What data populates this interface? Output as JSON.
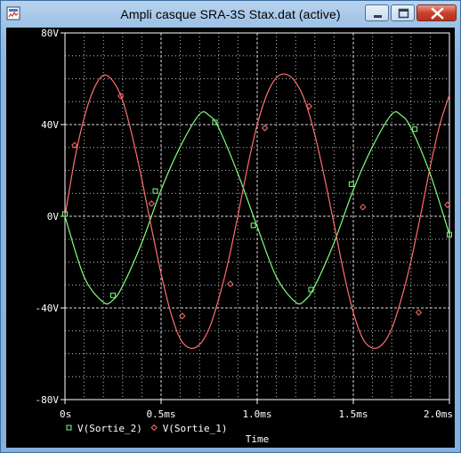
{
  "window": {
    "title": "Ampli casque SRA-3S Stax.dat (active)",
    "icons": [
      "app-probe-icon",
      "minimize-icon",
      "maximize-icon",
      "close-icon"
    ]
  },
  "colors": {
    "background": "#000000",
    "grid": "#ffffff",
    "series_sortie_2": "#7dff7d",
    "series_sortie_1": "#ff6f6f"
  },
  "chart_data": {
    "type": "line",
    "xlabel": "Time",
    "ylabel": "",
    "xlim": [
      0,
      2.0
    ],
    "ylim": [
      -80,
      80
    ],
    "x_unit": "ms",
    "y_unit": "V",
    "x_ticks": [
      0,
      0.5,
      1.0,
      1.5,
      2.0
    ],
    "x_tick_labels": [
      "0s",
      "0.5ms",
      "1.0ms",
      "1.5ms",
      "2.0ms"
    ],
    "y_ticks": [
      80,
      40,
      0,
      -40,
      -80
    ],
    "y_tick_labels": [
      "80V",
      "40V",
      "0V",
      "-40V",
      "-80V"
    ],
    "grid": true,
    "legend_position": "bottom-left",
    "series": [
      {
        "name": "V(Sortie_2)",
        "marker": "square",
        "color": "#7dff7d",
        "x": [
          0,
          0.1,
          0.2,
          0.25,
          0.3,
          0.4,
          0.5,
          0.6,
          0.7,
          0.75,
          0.8,
          0.9,
          1.0,
          1.1,
          1.2,
          1.25,
          1.3,
          1.4,
          1.5,
          1.6,
          1.7,
          1.75,
          1.8,
          1.9,
          2.0
        ],
        "values": [
          0,
          -26.5,
          -37.5,
          -36.5,
          -30.4,
          -11.5,
          11.5,
          30.4,
          44.5,
          44.0,
          38.5,
          18.5,
          -4.5,
          -26.5,
          -37.5,
          -36.5,
          -30.4,
          -11.5,
          11.5,
          30.4,
          44.5,
          44.0,
          38.5,
          18.5,
          -8.0
        ],
        "marker_points": [
          [
            0.0,
            1.0
          ],
          [
            0.25,
            -34.5
          ],
          [
            0.47,
            11.0
          ],
          [
            0.78,
            41.0
          ],
          [
            0.98,
            -4.0
          ],
          [
            1.28,
            -32.0
          ],
          [
            1.49,
            14.0
          ],
          [
            1.82,
            38.0
          ],
          [
            2.0,
            -8.0
          ]
        ]
      },
      {
        "name": "V(Sortie_1)",
        "marker": "diamond",
        "color": "#ff6f6f",
        "x": [
          0,
          0.05,
          0.1,
          0.15,
          0.2,
          0.25,
          0.3,
          0.35,
          0.4,
          0.45,
          0.5,
          0.55,
          0.6,
          0.65,
          0.7,
          0.75,
          0.8,
          0.85,
          0.9,
          0.95,
          1.0,
          1.05,
          1.1,
          1.15,
          1.2,
          1.25,
          1.3,
          1.35,
          1.4,
          1.45,
          1.5,
          1.55,
          1.6,
          1.65,
          1.7,
          1.75,
          1.8,
          1.85,
          1.9,
          1.95,
          2.0
        ],
        "values": [
          0,
          24.5,
          43.0,
          55.5,
          61.5,
          59.0,
          50.5,
          35.0,
          16.0,
          -5.0,
          -25.0,
          -42.0,
          -53.5,
          -57.5,
          -56.0,
          -49.0,
          -36.0,
          -19.5,
          0.5,
          21.5,
          40.0,
          53.0,
          60.5,
          62.0,
          58.5,
          50.0,
          35.5,
          17.0,
          -3.5,
          -24.5,
          -42.0,
          -53.5,
          -57.5,
          -56.0,
          -49.0,
          -36.0,
          -19.5,
          0.5,
          21.5,
          40.0,
          53.0
        ],
        "marker_points": [
          [
            0.05,
            31.0
          ],
          [
            0.29,
            52.5
          ],
          [
            0.45,
            5.5
          ],
          [
            0.61,
            -43.5
          ],
          [
            0.86,
            -29.5
          ],
          [
            1.04,
            38.5
          ],
          [
            1.27,
            48.0
          ],
          [
            1.55,
            4.0
          ],
          [
            1.84,
            -42.0
          ],
          [
            1.99,
            5.0
          ]
        ]
      }
    ]
  }
}
